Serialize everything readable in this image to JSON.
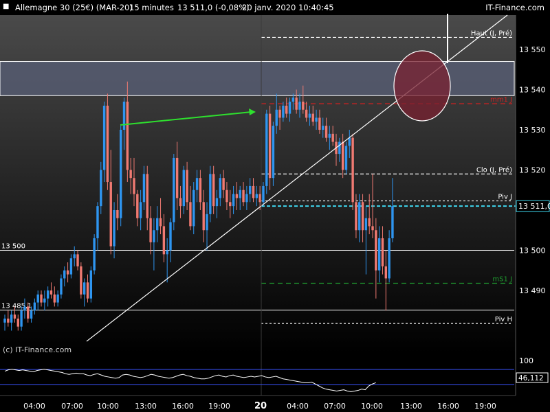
{
  "header": {
    "instrument": "Allemagne 30 (25€) (MAR-20)",
    "timeframe": "15 minutes",
    "quote": "13 511,0 (-0,08%)",
    "datetime": "20 janv. 2020 10:40:45",
    "brand": "IT-Finance.com"
  },
  "watermark": "(c) IT-Finance.com",
  "chart_data": {
    "type": "candlestick",
    "y_axis_ticks": [
      13490,
      13500,
      13510,
      13520,
      13530,
      13540,
      13550
    ],
    "y_axis_labels": [
      "13 490",
      "13 500",
      "13 510",
      "13 520",
      "13 530",
      "13 540",
      "13 550"
    ],
    "y_axis_label_values": [
      13490,
      13500,
      13520,
      13530,
      13540,
      13550
    ],
    "ylim": [
      13479,
      13561
    ],
    "x_axis_labels": [
      "04:00",
      "07:00",
      "10:00",
      "13:00",
      "16:00",
      "19:00",
      "20",
      "04:00",
      "07:00",
      "10:00",
      "13:00",
      "16:00",
      "19:00"
    ],
    "x_separator_label": "20",
    "last_price": 13511.0,
    "last_price_label": "13 511,0",
    "candles": [
      [
        13482,
        13484,
        13480,
        13483
      ],
      [
        13483,
        13485,
        13481,
        13482
      ],
      [
        13482,
        13485,
        13480,
        13484
      ],
      [
        13484,
        13486,
        13482,
        13483
      ],
      [
        13483,
        13484,
        13480,
        13481
      ],
      [
        13481,
        13486,
        13480,
        13485
      ],
      [
        13485,
        13488,
        13483,
        13486
      ],
      [
        13486,
        13487,
        13482,
        13483
      ],
      [
        13483,
        13486,
        13482,
        13485
      ],
      [
        13485,
        13488,
        13484,
        13487
      ],
      [
        13487,
        13490,
        13485,
        13489
      ],
      [
        13489,
        13490,
        13486,
        13487
      ],
      [
        13487,
        13490,
        13485,
        13488
      ],
      [
        13488,
        13491,
        13486,
        13490
      ],
      [
        13490,
        13492,
        13488,
        13489
      ],
      [
        13489,
        13491,
        13486,
        13487
      ],
      [
        13487,
        13490,
        13486,
        13489
      ],
      [
        13489,
        13494,
        13488,
        13493
      ],
      [
        13493,
        13496,
        13491,
        13495
      ],
      [
        13495,
        13497,
        13492,
        13494
      ],
      [
        13494,
        13499,
        13493,
        13498
      ],
      [
        13498,
        13501,
        13496,
        13499
      ],
      [
        13499,
        13500,
        13495,
        13496
      ],
      [
        13496,
        13497,
        13488,
        13489
      ],
      [
        13489,
        13493,
        13486,
        13492
      ],
      [
        13492,
        13494,
        13487,
        13488
      ],
      [
        13488,
        13496,
        13487,
        13495
      ],
      [
        13495,
        13504,
        13494,
        13503
      ],
      [
        13503,
        13512,
        13500,
        13511
      ],
      [
        13511,
        13522,
        13509,
        13520
      ],
      [
        13520,
        13537,
        13517,
        13536
      ],
      [
        13536,
        13539,
        13515,
        13517
      ],
      [
        13517,
        13525,
        13499,
        13501
      ],
      [
        13501,
        13512,
        13498,
        13510
      ],
      [
        13510,
        13514,
        13505,
        13508
      ],
      [
        13508,
        13531,
        13506,
        13530
      ],
      [
        13530,
        13538,
        13525,
        13537
      ],
      [
        13537,
        13542,
        13517,
        13520
      ],
      [
        13520,
        13523,
        13514,
        13518
      ],
      [
        13518,
        13523,
        13511,
        13514
      ],
      [
        13514,
        13515,
        13506,
        13508
      ],
      [
        13508,
        13515,
        13505,
        13512
      ],
      [
        13512,
        13521,
        13510,
        13519
      ],
      [
        13519,
        13521,
        13505,
        13508
      ],
      [
        13508,
        13511,
        13499,
        13502
      ],
      [
        13502,
        13508,
        13495,
        13505
      ],
      [
        13505,
        13511,
        13502,
        13508
      ],
      [
        13508,
        13513,
        13504,
        13506
      ],
      [
        13506,
        13509,
        13497,
        13499
      ],
      [
        13499,
        13503,
        13492,
        13500
      ],
      [
        13500,
        13508,
        13497,
        13507
      ],
      [
        13507,
        13524,
        13505,
        13523
      ],
      [
        13523,
        13527,
        13510,
        13513
      ],
      [
        13513,
        13516,
        13508,
        13511
      ],
      [
        13511,
        13521,
        13509,
        13520
      ],
      [
        13520,
        13522,
        13510,
        13512
      ],
      [
        13512,
        13516,
        13505,
        13506
      ],
      [
        13506,
        13517,
        13504,
        13515
      ],
      [
        13515,
        13520,
        13512,
        13518
      ],
      [
        13518,
        13520,
        13510,
        13512
      ],
      [
        13512,
        13515,
        13502,
        13505
      ],
      [
        13505,
        13512,
        13500,
        13509
      ],
      [
        13509,
        13521,
        13507,
        13519
      ],
      [
        13519,
        13521,
        13509,
        13511
      ],
      [
        13511,
        13515,
        13508,
        13513
      ],
      [
        13513,
        13519,
        13511,
        13518
      ],
      [
        13518,
        13520,
        13513,
        13515
      ],
      [
        13515,
        13517,
        13510,
        13512
      ],
      [
        13512,
        13515,
        13508,
        13511
      ],
      [
        13511,
        13516,
        13509,
        13514
      ],
      [
        13514,
        13517,
        13510,
        13513
      ],
      [
        13513,
        13516,
        13510,
        13515
      ],
      [
        13515,
        13517,
        13511,
        13512
      ],
      [
        13512,
        13516,
        13510,
        13514
      ],
      [
        13514,
        13518,
        13512,
        13516
      ],
      [
        13516,
        13518,
        13512,
        13513
      ],
      [
        13513,
        13516,
        13511,
        13514
      ],
      [
        13514,
        13516,
        13510,
        13512
      ],
      [
        13512,
        13517,
        13511,
        13516
      ],
      [
        13516,
        13535,
        13514,
        13534
      ],
      [
        13534,
        13536,
        13515,
        13518
      ],
      [
        13518,
        13532,
        13516,
        13531
      ],
      [
        13531,
        13539,
        13529,
        13535
      ],
      [
        13535,
        13536,
        13530,
        13533
      ],
      [
        13533,
        13537,
        13532,
        13536
      ],
      [
        13536,
        13538,
        13533,
        13534
      ],
      [
        13534,
        13538,
        13532,
        13537
      ],
      [
        13537,
        13539,
        13535,
        13538
      ],
      [
        13538,
        13540,
        13534,
        13535
      ],
      [
        13535,
        13539,
        13533,
        13537
      ],
      [
        13537,
        13541,
        13534,
        13535
      ],
      [
        13535,
        13537,
        13532,
        13533
      ],
      [
        13533,
        13536,
        13531,
        13534
      ],
      [
        13534,
        13536,
        13531,
        13532
      ],
      [
        13532,
        13535,
        13530,
        13533
      ],
      [
        13533,
        13535,
        13529,
        13530
      ],
      [
        13530,
        13533,
        13528,
        13531
      ],
      [
        13531,
        13533,
        13527,
        13528
      ],
      [
        13528,
        13531,
        13525,
        13529
      ],
      [
        13529,
        13531,
        13526,
        13527
      ],
      [
        13527,
        13529,
        13521,
        13524
      ],
      [
        13524,
        13528,
        13522,
        13527
      ],
      [
        13527,
        13529,
        13518,
        13520
      ],
      [
        13520,
        13527,
        13519,
        13526
      ],
      [
        13526,
        13530,
        13523,
        13528
      ],
      [
        13528,
        13529,
        13510,
        13512
      ],
      [
        13512,
        13514,
        13503,
        13505
      ],
      [
        13505,
        13514,
        13502,
        13512
      ],
      [
        13512,
        13514,
        13502,
        13505
      ],
      [
        13505,
        13511,
        13494,
        13508
      ],
      [
        13508,
        13514,
        13504,
        13506
      ],
      [
        13506,
        13519,
        13503,
        13505
      ],
      [
        13505,
        13508,
        13488,
        13495
      ],
      [
        13495,
        13506,
        13492,
        13503
      ],
      [
        13503,
        13506,
        13494,
        13496
      ],
      [
        13496,
        13500,
        13485,
        13493
      ],
      [
        13493,
        13505,
        13492,
        13503
      ],
      [
        13503,
        13518,
        13502,
        13511
      ]
    ]
  },
  "levels": [
    {
      "label": "Haut (J, Pré)",
      "value": 13553.0,
      "color": "#ffffff",
      "dash": "5,3"
    },
    {
      "label": "mm1 J",
      "value": 13536.5,
      "color": "#cc2222",
      "dash": "7,5"
    },
    {
      "label": "Clo (J, Pré)",
      "value": 13519.0,
      "color": "#ffffff",
      "dash": "5,3"
    },
    {
      "label": "Piv J",
      "value": 13512.3,
      "color": "#ffffff",
      "dash": "3,3"
    },
    {
      "label": "mS1 J",
      "value": 13491.8,
      "color": "#1f9a2f",
      "dash": "7,5"
    },
    {
      "label": "Piv H",
      "value": 13481.8,
      "color": "#ffffff",
      "dash": "3,3"
    }
  ],
  "zone": {
    "top": 13547.0,
    "bottom": 13538.5
  },
  "hlines": [
    {
      "label": "13 500",
      "value": 13500.0
    },
    {
      "label": "13 485,1",
      "value": 13485.1
    }
  ],
  "oscillator": {
    "upper_label": "100",
    "value_label": "46,112",
    "values": [
      78,
      80,
      81,
      80,
      79,
      80,
      79,
      78,
      77,
      79,
      80,
      81,
      80,
      79,
      78,
      77,
      76,
      74,
      73,
      74,
      75,
      74,
      74,
      72,
      71,
      73,
      74,
      72,
      70,
      69,
      68,
      67,
      68,
      72,
      73,
      72,
      70,
      69,
      68,
      69,
      71,
      73,
      72,
      70,
      69,
      68,
      67,
      68,
      70,
      72,
      73,
      71,
      70,
      68,
      67,
      66,
      66,
      67,
      69,
      71,
      72,
      70,
      69,
      71,
      72,
      70,
      69,
      68,
      69,
      70,
      69,
      70,
      71,
      69,
      68,
      69,
      70,
      68,
      66,
      65,
      64,
      63,
      62,
      61,
      60,
      60,
      61,
      58,
      55,
      52,
      50,
      49,
      48,
      47,
      48,
      49,
      47,
      46,
      47,
      48,
      50,
      49,
      55,
      58,
      60
    ]
  }
}
